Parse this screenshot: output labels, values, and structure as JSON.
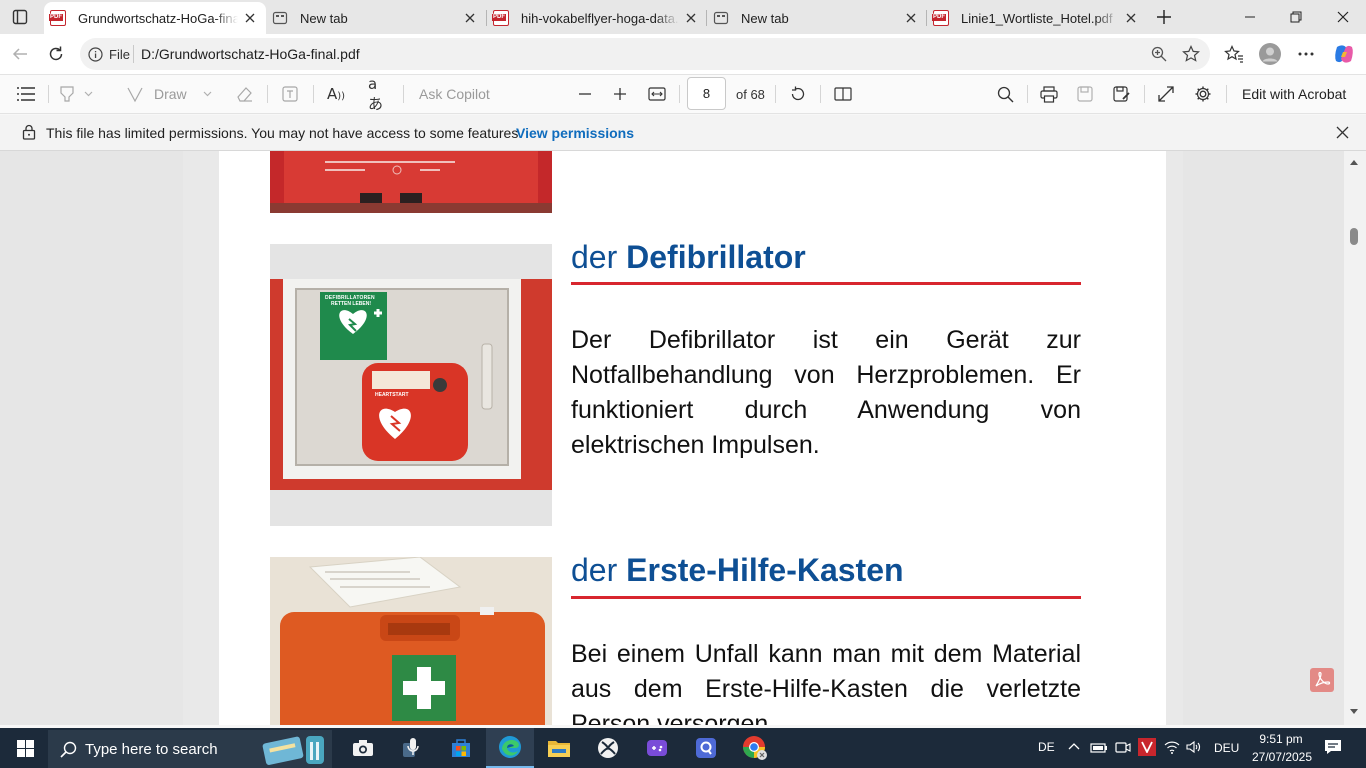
{
  "tabs": [
    {
      "title": "Grundwortschatz-HoGa-final.pdf",
      "icon": "pdf-icon",
      "active": true
    },
    {
      "title": "New tab",
      "icon": "new-tab-icon",
      "active": false
    },
    {
      "title": "hih-vokabelflyer-hoga-data.pdf",
      "icon": "pdf-icon",
      "active": false
    },
    {
      "title": "New tab",
      "icon": "new-tab-icon",
      "active": false
    },
    {
      "title": "Linie1_Wortliste_Hotel.pdf",
      "icon": "pdf-icon",
      "active": false
    }
  ],
  "address": {
    "scheme_label": "File",
    "url": "D:/Grundwortschatz-HoGa-final.pdf"
  },
  "pdf_toolbar": {
    "draw_label": "Draw",
    "ask_copilot_label": "Ask Copilot",
    "page_number": "8",
    "page_total_label": "of 68",
    "edit_acrobat_label": "Edit with Acrobat"
  },
  "info_bar": {
    "message": "This file has limited permissions. You may not have access to some features.",
    "link": "View permissions"
  },
  "document": {
    "entry1": {
      "article": "der",
      "word": "Defibrillator",
      "text": "Der Defibrillator ist ein Gerät zur Notfallbehandlung von Herzproblemen. Er funktioniert durch Anwendung von elektrischen Impulsen."
    },
    "entry2": {
      "article": "der",
      "word": "Erste-Hilfe-Kasten",
      "text": "Bei einem Unfall kann man mit dem Material aus dem Erste-Hilfe-Kasten die verletzte Person versorgen."
    },
    "sign_line1": "DEFIBRILLATOREN",
    "sign_line2": "RETTEN LEBEN!",
    "device_label": "HEARTSTART"
  },
  "taskbar": {
    "search_placeholder": "Type here to search",
    "lang_short": "DE",
    "lang_code": "DEU",
    "time": "9:51 pm",
    "date": "27/07/2025"
  },
  "colors": {
    "heading_blue": "#0e4f94",
    "rule_red": "#d8262e",
    "taskbar_bg": "#1c2a3a"
  }
}
